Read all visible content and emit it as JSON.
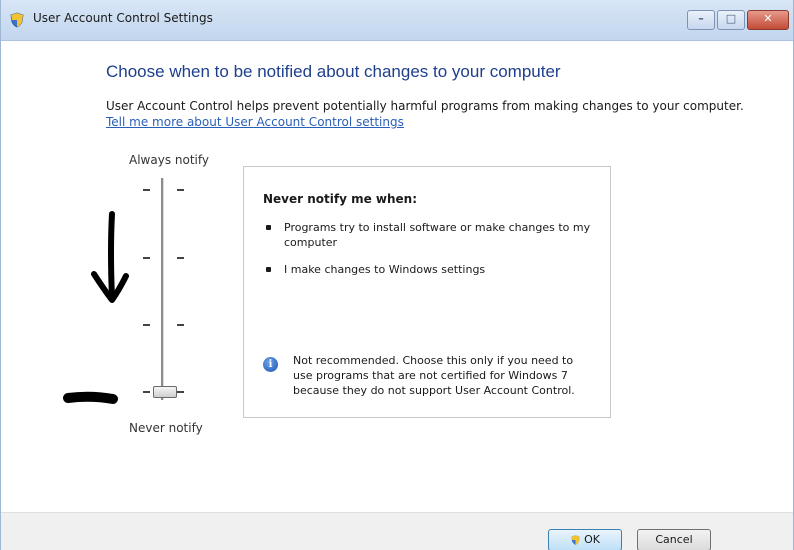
{
  "window": {
    "title": "User Account Control Settings",
    "controls": {
      "minimize": "–",
      "maximize": "□",
      "close": "✕"
    }
  },
  "main": {
    "heading": "Choose when to be notified about changes to your computer",
    "description": "User Account Control helps prevent potentially harmful programs from making changes to your computer.",
    "link": "Tell me more about User Account Control settings"
  },
  "slider": {
    "top_label": "Always notify",
    "bottom_label": "Never notify",
    "levels": 4,
    "selected_level": 1
  },
  "info": {
    "title": "Never notify me when:",
    "bullets": [
      "Programs try to install software or make changes to my computer",
      "I make changes to Windows settings"
    ],
    "note": "Not recommended. Choose this only if you need to use programs that are not certified for Windows 7 because they do not support User Account Control."
  },
  "footer": {
    "ok_label": "OK",
    "cancel_label": "Cancel"
  },
  "icons": {
    "title": "uac-shield-icon",
    "info": "info-icon",
    "ok": "uac-shield-icon"
  },
  "colors": {
    "heading": "#1e3f8c",
    "link": "#2a5fb8",
    "titlebar": "#c2d6ee"
  }
}
